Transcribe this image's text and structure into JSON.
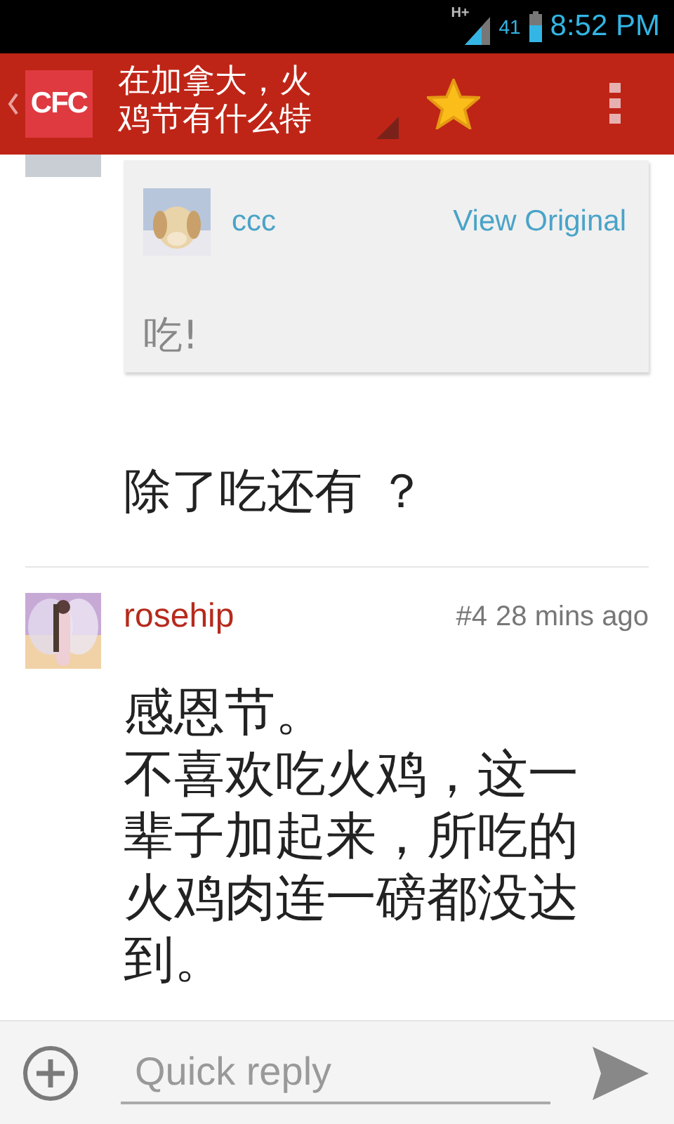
{
  "status_bar": {
    "network": "H+",
    "battery_text": "41",
    "time": "8:52 PM"
  },
  "action_bar": {
    "logo": "CFC",
    "title": "在加拿大，火鸡节有什么特",
    "starred": true
  },
  "quote": {
    "author": "ccc",
    "link": "View Original",
    "text": "吃!"
  },
  "reply_text": "除了吃还有 ？",
  "posts": [
    {
      "author": "rosehip",
      "number": "#4",
      "time": "28 mins ago",
      "paragraphs": [
        "感恩节。",
        "不喜欢吃火鸡，这一辈子加起来，所吃的火鸡肉连一磅都没达到。"
      ]
    }
  ],
  "reply_bar": {
    "placeholder": "Quick reply"
  }
}
